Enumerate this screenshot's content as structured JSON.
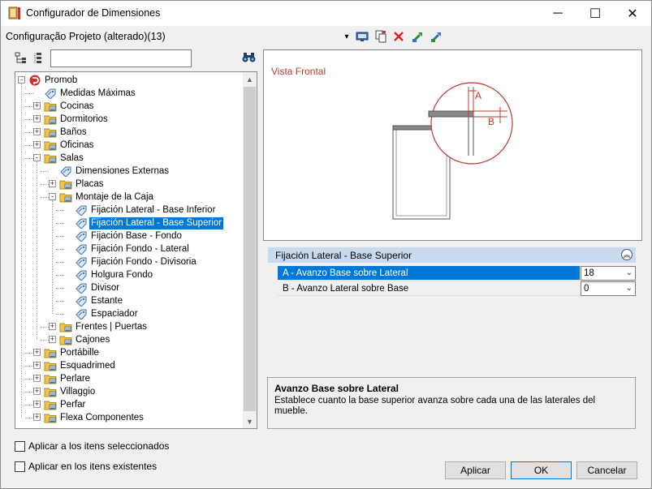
{
  "window": {
    "title": "Configurador de Dimensiones",
    "minimize_glyph": "─",
    "maximize_glyph": "☐",
    "close_glyph": "✕"
  },
  "config": {
    "name": "Configuração Projeto (alterado)(13)",
    "dropdown_glyph": "▾"
  },
  "toolbar_icons": [
    "monitor-icon",
    "copy-icon",
    "delete-icon",
    "import-icon",
    "export-icon"
  ],
  "search": {
    "value": "",
    "placeholder": ""
  },
  "tree": [
    {
      "label": "Promob",
      "level": 0,
      "expander": "-",
      "icon": "promob-logo-icon"
    },
    {
      "label": "Medidas Máximas",
      "level": 1,
      "expander": "",
      "icon": "tag-icon"
    },
    {
      "label": "Cocinas",
      "level": 1,
      "expander": "+",
      "icon": "folder-icon"
    },
    {
      "label": "Dormitorios",
      "level": 1,
      "expander": "+",
      "icon": "folder-icon"
    },
    {
      "label": "Baños",
      "level": 1,
      "expander": "+",
      "icon": "folder-icon"
    },
    {
      "label": "Oficinas",
      "level": 1,
      "expander": "+",
      "icon": "folder-icon"
    },
    {
      "label": "Salas",
      "level": 1,
      "expander": "-",
      "icon": "folder-icon"
    },
    {
      "label": "Dimensiones Externas",
      "level": 2,
      "expander": "",
      "icon": "tag-icon"
    },
    {
      "label": "Placas",
      "level": 2,
      "expander": "+",
      "icon": "folder-icon"
    },
    {
      "label": "Montaje de la Caja",
      "level": 2,
      "expander": "-",
      "icon": "folder-icon"
    },
    {
      "label": "Fijación Lateral - Base Inferior",
      "level": 3,
      "expander": "",
      "icon": "tag-icon"
    },
    {
      "label": "Fijación Lateral - Base Superior",
      "level": 3,
      "expander": "",
      "icon": "tag-icon",
      "selected": true
    },
    {
      "label": "Fijación Base - Fondo",
      "level": 3,
      "expander": "",
      "icon": "tag-icon"
    },
    {
      "label": "Fijación Fondo - Lateral",
      "level": 3,
      "expander": "",
      "icon": "tag-icon"
    },
    {
      "label": "Fijación Fondo - Divisoria",
      "level": 3,
      "expander": "",
      "icon": "tag-icon"
    },
    {
      "label": "Holgura Fondo",
      "level": 3,
      "expander": "",
      "icon": "tag-icon"
    },
    {
      "label": "Divisor",
      "level": 3,
      "expander": "",
      "icon": "tag-icon"
    },
    {
      "label": "Estante",
      "level": 3,
      "expander": "",
      "icon": "tag-icon"
    },
    {
      "label": "Espaciador",
      "level": 3,
      "expander": "",
      "icon": "tag-icon"
    },
    {
      "label": "Frentes | Puertas",
      "level": 2,
      "expander": "+",
      "icon": "folder-icon"
    },
    {
      "label": "Cajones",
      "level": 2,
      "expander": "+",
      "icon": "folder-icon"
    },
    {
      "label": "Portábille",
      "level": 1,
      "expander": "+",
      "icon": "folder-icon"
    },
    {
      "label": "Esquadrimed",
      "level": 1,
      "expander": "+",
      "icon": "folder-icon"
    },
    {
      "label": "Perlare",
      "level": 1,
      "expander": "+",
      "icon": "folder-icon"
    },
    {
      "label": "Villaggio",
      "level": 1,
      "expander": "+",
      "icon": "folder-icon"
    },
    {
      "label": "Perfar",
      "level": 1,
      "expander": "+",
      "icon": "folder-icon"
    },
    {
      "label": "Flexa Componentes",
      "level": 1,
      "expander": "+",
      "icon": "folder-icon"
    }
  ],
  "preview": {
    "title": "Vista Frontal",
    "label_a": "A",
    "label_b": "B"
  },
  "properties": {
    "header": "Fijación Lateral - Base Superior",
    "collapse_glyph": "︽",
    "rows": [
      {
        "name": "A - Avanzo Base sobre Lateral",
        "value": "18",
        "selected": true
      },
      {
        "name": "B - Avanzo Lateral sobre Base",
        "value": "0",
        "selected": false
      }
    ],
    "dropdown_glyph": "⌄"
  },
  "description": {
    "title": "Avanzo Base sobre Lateral",
    "text": "Establece cuanto la base superior avanza sobre cada una de las laterales del mueble."
  },
  "options": {
    "apply_selected": "Aplicar a los itens seleccionados",
    "apply_existing": "Aplicar en los itens existentes"
  },
  "buttons": {
    "apply": "Aplicar",
    "ok": "OK",
    "cancel": "Cancelar"
  },
  "colors": {
    "selection": "#0078d7",
    "preview_accent": "#c0392b",
    "property_header": "#c8daf0"
  }
}
